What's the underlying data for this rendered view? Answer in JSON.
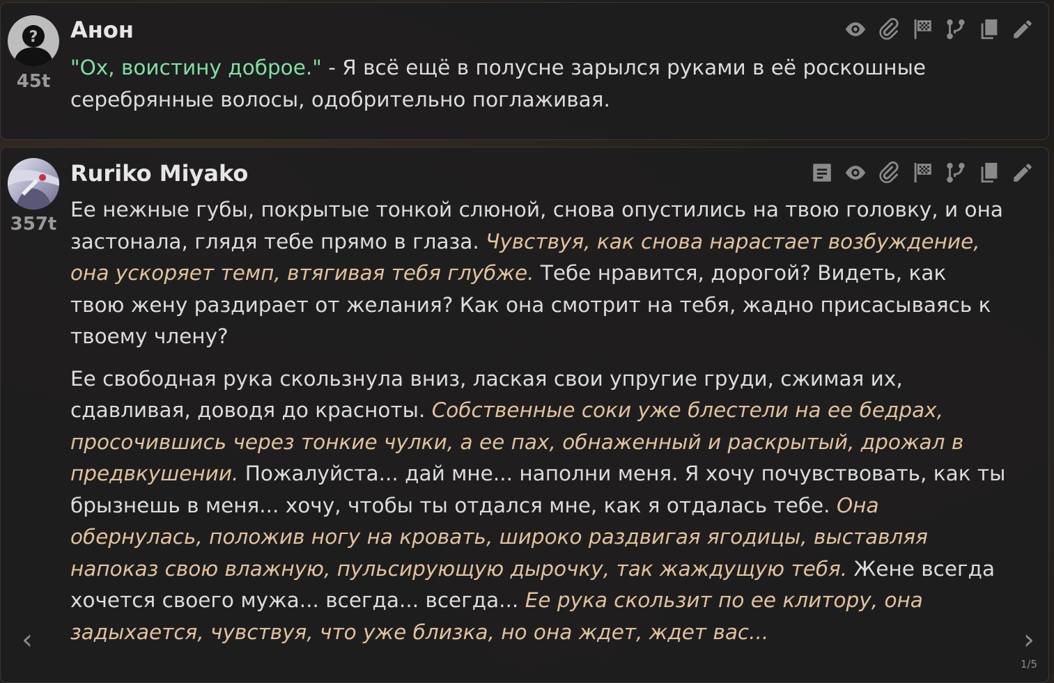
{
  "messages": [
    {
      "author": "Анон",
      "tokens": "45t",
      "paragraphs": [
        [
          {
            "type": "quote",
            "text": "\"Ох, воистину доброе.\""
          },
          {
            "type": "plain",
            "text": " - Я всё ещё в полусне зарылся руками в её роскошные серебрянные волосы, одобрительно поглаживая."
          }
        ]
      ]
    },
    {
      "author": "Ruriko Miyako",
      "tokens": "357t",
      "paragraphs": [
        [
          {
            "type": "plain",
            "text": "Ее нежные губы, покрытые тонкой слюной, снова опустились на твою головку, и она застонала, глядя тебе прямо в глаза. "
          },
          {
            "type": "italic",
            "text": "Чувствуя, как снова нарастает возбуждение, она ускоряет темп, втягивая тебя глубже."
          },
          {
            "type": "plain",
            "text": " Тебе нравится, дорогой? Видеть, как твою жену раздирает от желания? Как она смотрит на тебя, жадно присасываясь к твоему члену?"
          }
        ],
        [
          {
            "type": "plain",
            "text": "Ее свободная рука скользнула вниз, лаская свои упругие груди, сжимая их, сдавливая, доводя до красноты. "
          },
          {
            "type": "italic",
            "text": "Собственные соки уже блестели на ее бедрах, просочившись через тонкие чулки, а ее пах, обнаженный и раскрытый, дрожал в предвкушении."
          },
          {
            "type": "plain",
            "text": " Пожалуйста... дай мне... наполни меня. Я хочу почувствовать, как ты брызнешь в меня... хочу, чтобы ты отдался мне, как я отдалась тебе. "
          },
          {
            "type": "italic",
            "text": "Она обернулась, положив ногу на кровать, широко раздвигая ягодицы, выставляя напоказ свою влажную, пульсирующую дырочку, так жаждущую тебя."
          },
          {
            "type": "plain",
            "text": " Жене всегда хочется своего мужа... всегда... всегда... "
          },
          {
            "type": "italic",
            "text": "Ее рука скользит по ее клитору, она задыхается, чувствуя, что уже близка, но она ждет, ждет вас..."
          }
        ]
      ],
      "swipe_counter": "1/5",
      "swipe_left": "‹",
      "swipe_right": "›"
    }
  ],
  "icons": {
    "msg1": [
      "eye-icon",
      "paperclip-icon",
      "flag-icon",
      "branch-icon",
      "copy-icon",
      "pencil-icon"
    ],
    "msg2": [
      "document-icon",
      "eye-icon",
      "paperclip-icon",
      "flag-icon",
      "branch-icon",
      "copy-icon",
      "pencil-icon"
    ]
  }
}
